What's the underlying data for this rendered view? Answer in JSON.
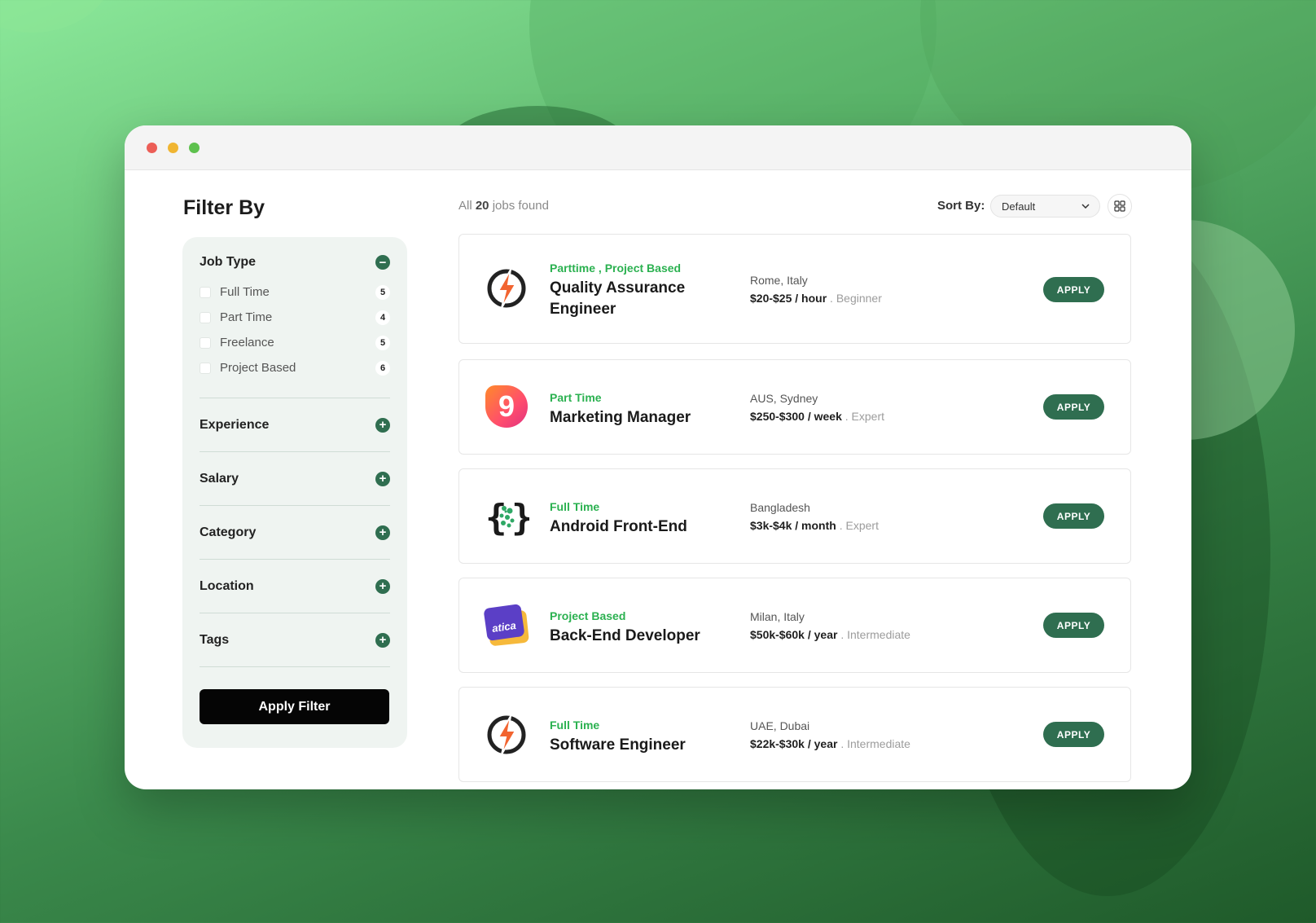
{
  "filters": {
    "title": "Filter By",
    "job_type": {
      "label": "Job Type",
      "options": [
        {
          "label": "Full Time",
          "count": "5"
        },
        {
          "label": "Part Time",
          "count": "4"
        },
        {
          "label": "Freelance",
          "count": "5"
        },
        {
          "label": "Project Based",
          "count": "6"
        }
      ]
    },
    "groups": [
      "Experience",
      "Salary",
      "Category",
      "Location",
      "Tags"
    ],
    "apply_label": "Apply Filter"
  },
  "results": {
    "prefix": "All",
    "count": "20",
    "suffix": "jobs found",
    "sort_label": "Sort By:",
    "sort_value": "Default"
  },
  "jobs": [
    {
      "type": "Parttime , Project Based",
      "title": "Quality Assurance Engineer",
      "location": "Rome, Italy",
      "salary": "$20-$25 / hour",
      "level": ". Beginner",
      "logo": "lightning-logo",
      "apply_label": "APPLY"
    },
    {
      "type": "Part Time",
      "title": "Marketing Manager",
      "location": "AUS, Sydney",
      "salary": "$250-$300 / week",
      "level": ". Expert",
      "logo": "nine-logo",
      "apply_label": "APPLY"
    },
    {
      "type": "Full Time",
      "title": "Android Front-End",
      "location": "Bangladesh",
      "salary": "$3k-$4k / month",
      "level": ". Expert",
      "logo": "braces-logo",
      "apply_label": "APPLY"
    },
    {
      "type": "Project Based",
      "title": "Back-End Developer",
      "location": "Milan, Italy",
      "salary": "$50k-$60k / year",
      "level": ". Intermediate",
      "logo": "atica-logo",
      "logo_text": "atica",
      "apply_label": "APPLY"
    },
    {
      "type": "Full Time",
      "title": "Software Engineer",
      "location": "UAE, Dubai",
      "salary": "$22k-$30k / year",
      "level": ". Intermediate",
      "logo": "lightning-logo",
      "apply_label": "APPLY"
    }
  ],
  "colors": {
    "accent": "#2f6e50",
    "type_green": "#2bb150"
  }
}
